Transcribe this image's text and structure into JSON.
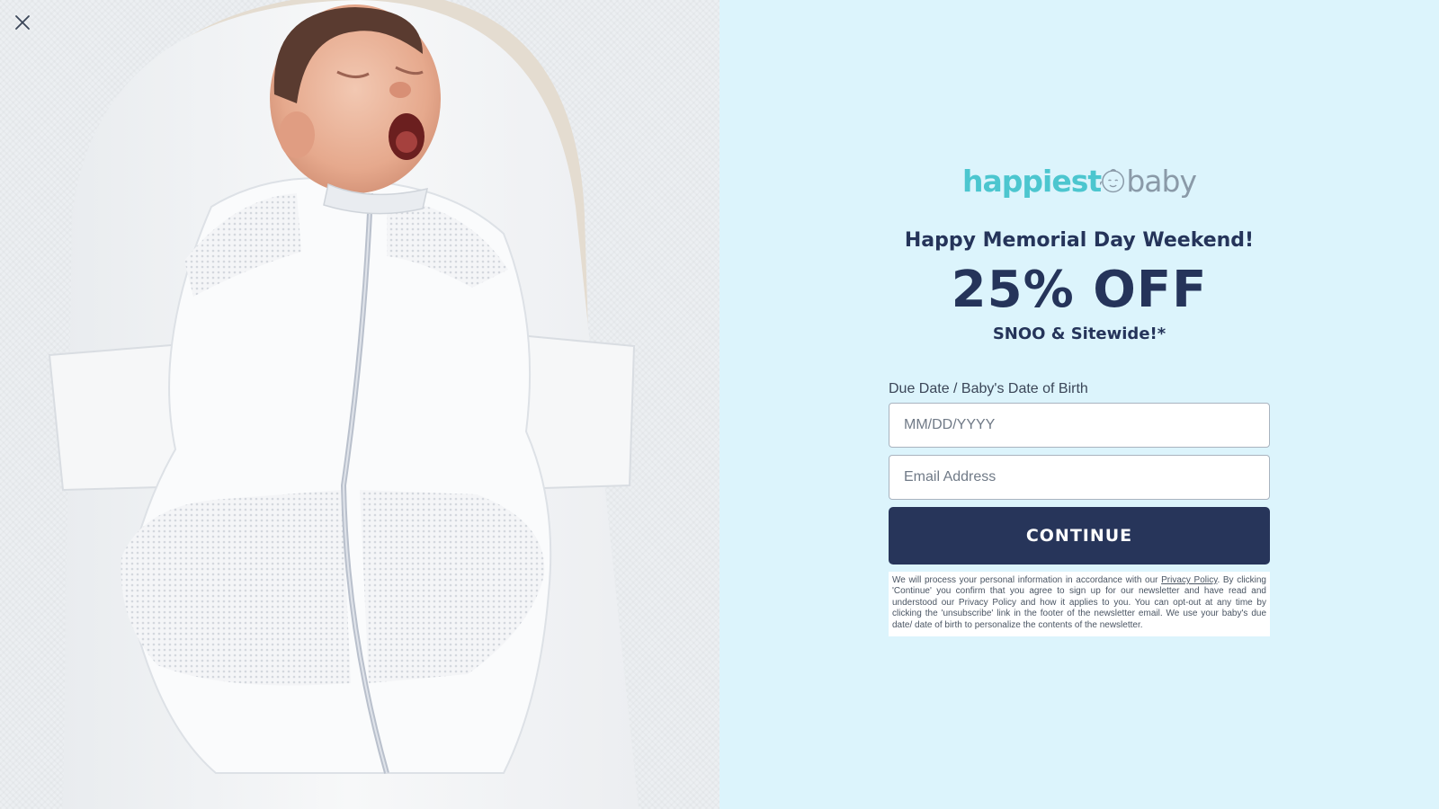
{
  "logo": {
    "part1": "happiest",
    "part2": "baby"
  },
  "promo": {
    "headline": "Happy Memorial Day Weekend!",
    "discount": "25% OFF",
    "subline": "SNOO & Sitewide!*"
  },
  "form": {
    "date_label": "Due Date / Baby's Date of Birth",
    "date_placeholder": "MM/DD/YYYY",
    "email_placeholder": "Email Address",
    "continue_label": "CONTINUE"
  },
  "disclaimer": {
    "before_link": "We will process your personal information in accordance with our ",
    "link_text": "Privacy Policy",
    "after_link": ". By clicking 'Continue' you confirm that you agree to sign up for our newsletter and have read and understood our Privacy Policy and how it applies to you. You can opt-out at any time by clicking the 'unsubscribe' link in the footer of the newsletter email. We use your baby's due date/ date of birth to personalize the contents of the newsletter."
  },
  "icons": {
    "close": "close-icon",
    "logo_face": "baby-face-icon"
  },
  "colors": {
    "background": "#dcf4fc",
    "navy": "#27355a",
    "logo_teal": "#4cc6cf",
    "logo_gray": "#8a9aa8"
  }
}
